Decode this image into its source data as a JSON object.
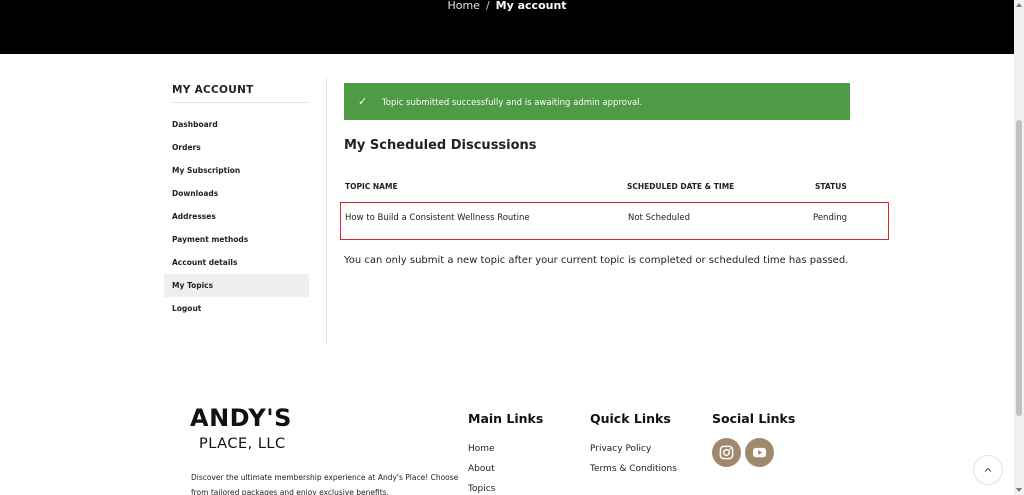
{
  "breadcrumb": {
    "home": "Home",
    "separator": "/",
    "current": "My account"
  },
  "sidebar": {
    "title": "MY ACCOUNT",
    "items": [
      {
        "label": "Dashboard",
        "active": false
      },
      {
        "label": "Orders",
        "active": false
      },
      {
        "label": "My Subscription",
        "active": false
      },
      {
        "label": "Downloads",
        "active": false
      },
      {
        "label": "Addresses",
        "active": false
      },
      {
        "label": "Payment methods",
        "active": false
      },
      {
        "label": "Account details",
        "active": false
      },
      {
        "label": "My Topics",
        "active": true
      },
      {
        "label": "Logout",
        "active": false
      }
    ]
  },
  "alert": {
    "message": "Topic submitted successfully and is awaiting admin approval.",
    "icon": "check-icon",
    "color": "#4f9a45"
  },
  "main": {
    "title": "My Scheduled Discussions",
    "table": {
      "headers": [
        "TOPIC NAME",
        "SCHEDULED DATE & TIME",
        "STATUS"
      ],
      "rows": [
        [
          "How to Build a Consistent Wellness Routine",
          "Not Scheduled",
          "Pending"
        ]
      ],
      "highlight_color": "#d9232d"
    },
    "notice": "You can only submit a new topic after your current topic is completed or scheduled time has passed."
  },
  "footer": {
    "logo": {
      "line1": "ANDY'S",
      "line2": "PLACE, LLC"
    },
    "description": "Discover the ultimate membership experience at Andy's Place! Choose from tailored packages and enjoy exclusive benefits.",
    "main_links": {
      "title": "Main Links",
      "items": [
        "Home",
        "About",
        "Topics"
      ]
    },
    "quick_links": {
      "title": "Quick Links",
      "items": [
        "Privacy Policy",
        "Terms & Conditions"
      ]
    },
    "social_links": {
      "title": "Social Links",
      "items": [
        {
          "icon": "instagram-icon"
        },
        {
          "icon": "youtube-icon"
        }
      ],
      "color": "#a08a6e"
    }
  },
  "scroll_to_top": {
    "icon": "chevron-up-icon"
  }
}
